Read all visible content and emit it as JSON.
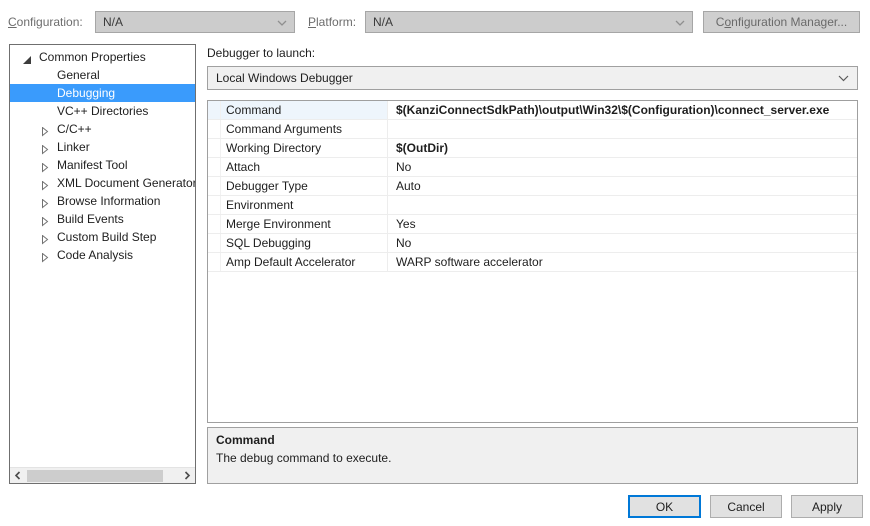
{
  "toolbar": {
    "configuration_label": "Configuration:",
    "configuration_value": "N/A",
    "platform_label": "Platform:",
    "platform_value": "N/A",
    "config_manager_button": "Configuration Manager..."
  },
  "tree": {
    "items": [
      {
        "label": "Common Properties",
        "level": 0,
        "state": "expanded",
        "selected": false
      },
      {
        "label": "General",
        "level": 1,
        "state": "leaf",
        "selected": false
      },
      {
        "label": "Debugging",
        "level": 1,
        "state": "leaf",
        "selected": true
      },
      {
        "label": "VC++ Directories",
        "level": 1,
        "state": "leaf",
        "selected": false
      },
      {
        "label": "C/C++",
        "level": 1,
        "state": "collapsed",
        "selected": false
      },
      {
        "label": "Linker",
        "level": 1,
        "state": "collapsed",
        "selected": false
      },
      {
        "label": "Manifest Tool",
        "level": 1,
        "state": "collapsed",
        "selected": false
      },
      {
        "label": "XML Document Generator",
        "level": 1,
        "state": "collapsed",
        "selected": false
      },
      {
        "label": "Browse Information",
        "level": 1,
        "state": "collapsed",
        "selected": false
      },
      {
        "label": "Build Events",
        "level": 1,
        "state": "collapsed",
        "selected": false
      },
      {
        "label": "Custom Build Step",
        "level": 1,
        "state": "collapsed",
        "selected": false
      },
      {
        "label": "Code Analysis",
        "level": 1,
        "state": "collapsed",
        "selected": false
      }
    ]
  },
  "debugger": {
    "label": "Debugger to launch:",
    "selected_value": "Local Windows Debugger"
  },
  "properties": {
    "rows": [
      {
        "name": "Command",
        "value": "$(KanziConnectSdkPath)\\output\\Win32\\$(Configuration)\\connect_server.exe",
        "bold": true,
        "selected": true
      },
      {
        "name": "Command Arguments",
        "value": "",
        "bold": false,
        "selected": false
      },
      {
        "name": "Working Directory",
        "value": "$(OutDir)",
        "bold": true,
        "selected": false
      },
      {
        "name": "Attach",
        "value": "No",
        "bold": false,
        "selected": false
      },
      {
        "name": "Debugger Type",
        "value": "Auto",
        "bold": false,
        "selected": false
      },
      {
        "name": "Environment",
        "value": "",
        "bold": false,
        "selected": false
      },
      {
        "name": "Merge Environment",
        "value": "Yes",
        "bold": false,
        "selected": false
      },
      {
        "name": "SQL Debugging",
        "value": "No",
        "bold": false,
        "selected": false
      },
      {
        "name": "Amp Default Accelerator",
        "value": "WARP software accelerator",
        "bold": false,
        "selected": false
      }
    ]
  },
  "description": {
    "title": "Command",
    "text": "The debug command to execute."
  },
  "footer": {
    "ok_label": "OK",
    "cancel_label": "Cancel",
    "apply_label": "Apply"
  },
  "colors": {
    "selection_blue": "#3a9bfc",
    "default_button_border": "#0078d7",
    "panel_gray": "#f0f0f0",
    "disabled_fill": "#cccccc"
  }
}
